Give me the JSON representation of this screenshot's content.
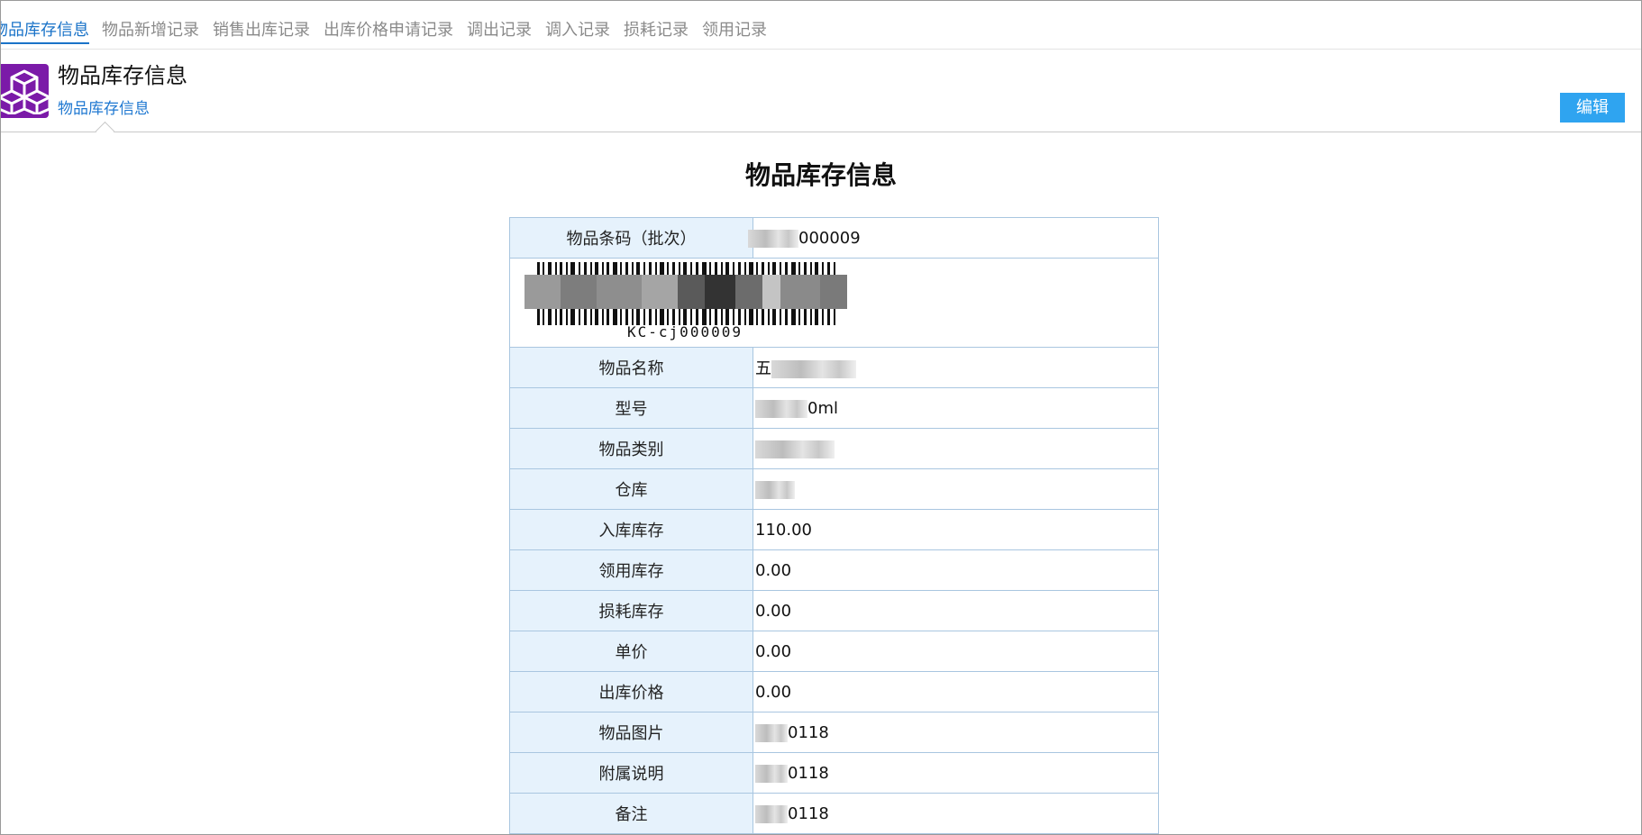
{
  "tabs": [
    {
      "label": "物品库存信息",
      "active": true
    },
    {
      "label": "物品新增记录",
      "active": false
    },
    {
      "label": "销售出库记录",
      "active": false
    },
    {
      "label": "出库价格申请记录",
      "active": false
    },
    {
      "label": "调出记录",
      "active": false
    },
    {
      "label": "调入记录",
      "active": false
    },
    {
      "label": "损耗记录",
      "active": false
    },
    {
      "label": "领用记录",
      "active": false
    }
  ],
  "header": {
    "icon": "cubes-icon",
    "title": "物品库存信息",
    "subtitle": "物品库存信息",
    "edit_label": "编辑"
  },
  "page_title": "物品库存信息",
  "rows": {
    "barcode": {
      "label": "物品条码（批次）",
      "value": "000009"
    },
    "barcode_image": {
      "caption": "KC-cj000009"
    },
    "name": {
      "label": "物品名称",
      "value": "五"
    },
    "model": {
      "label": "型号",
      "value": "0ml"
    },
    "category": {
      "label": "物品类别",
      "value": ""
    },
    "warehouse": {
      "label": "仓库",
      "value": ""
    },
    "in_stock": {
      "label": "入库库存",
      "value": "110.00"
    },
    "used_stock": {
      "label": "领用库存",
      "value": "0.00"
    },
    "loss_stock": {
      "label": "损耗库存",
      "value": "0.00"
    },
    "unit_price": {
      "label": "单价",
      "value": "0.00"
    },
    "out_price": {
      "label": "出库价格",
      "value": "0.00"
    },
    "image": {
      "label": "物品图片",
      "value": "0118"
    },
    "note": {
      "label": "附属说明",
      "value": "0118"
    },
    "remark": {
      "label": "备注",
      "value": "0118"
    }
  },
  "colors": {
    "accent": "#1a73c8",
    "button": "#2fa4f0",
    "icon_bg": "#7b1aa8",
    "label_bg": "#e6f2fc",
    "border": "#a9c6e0"
  }
}
